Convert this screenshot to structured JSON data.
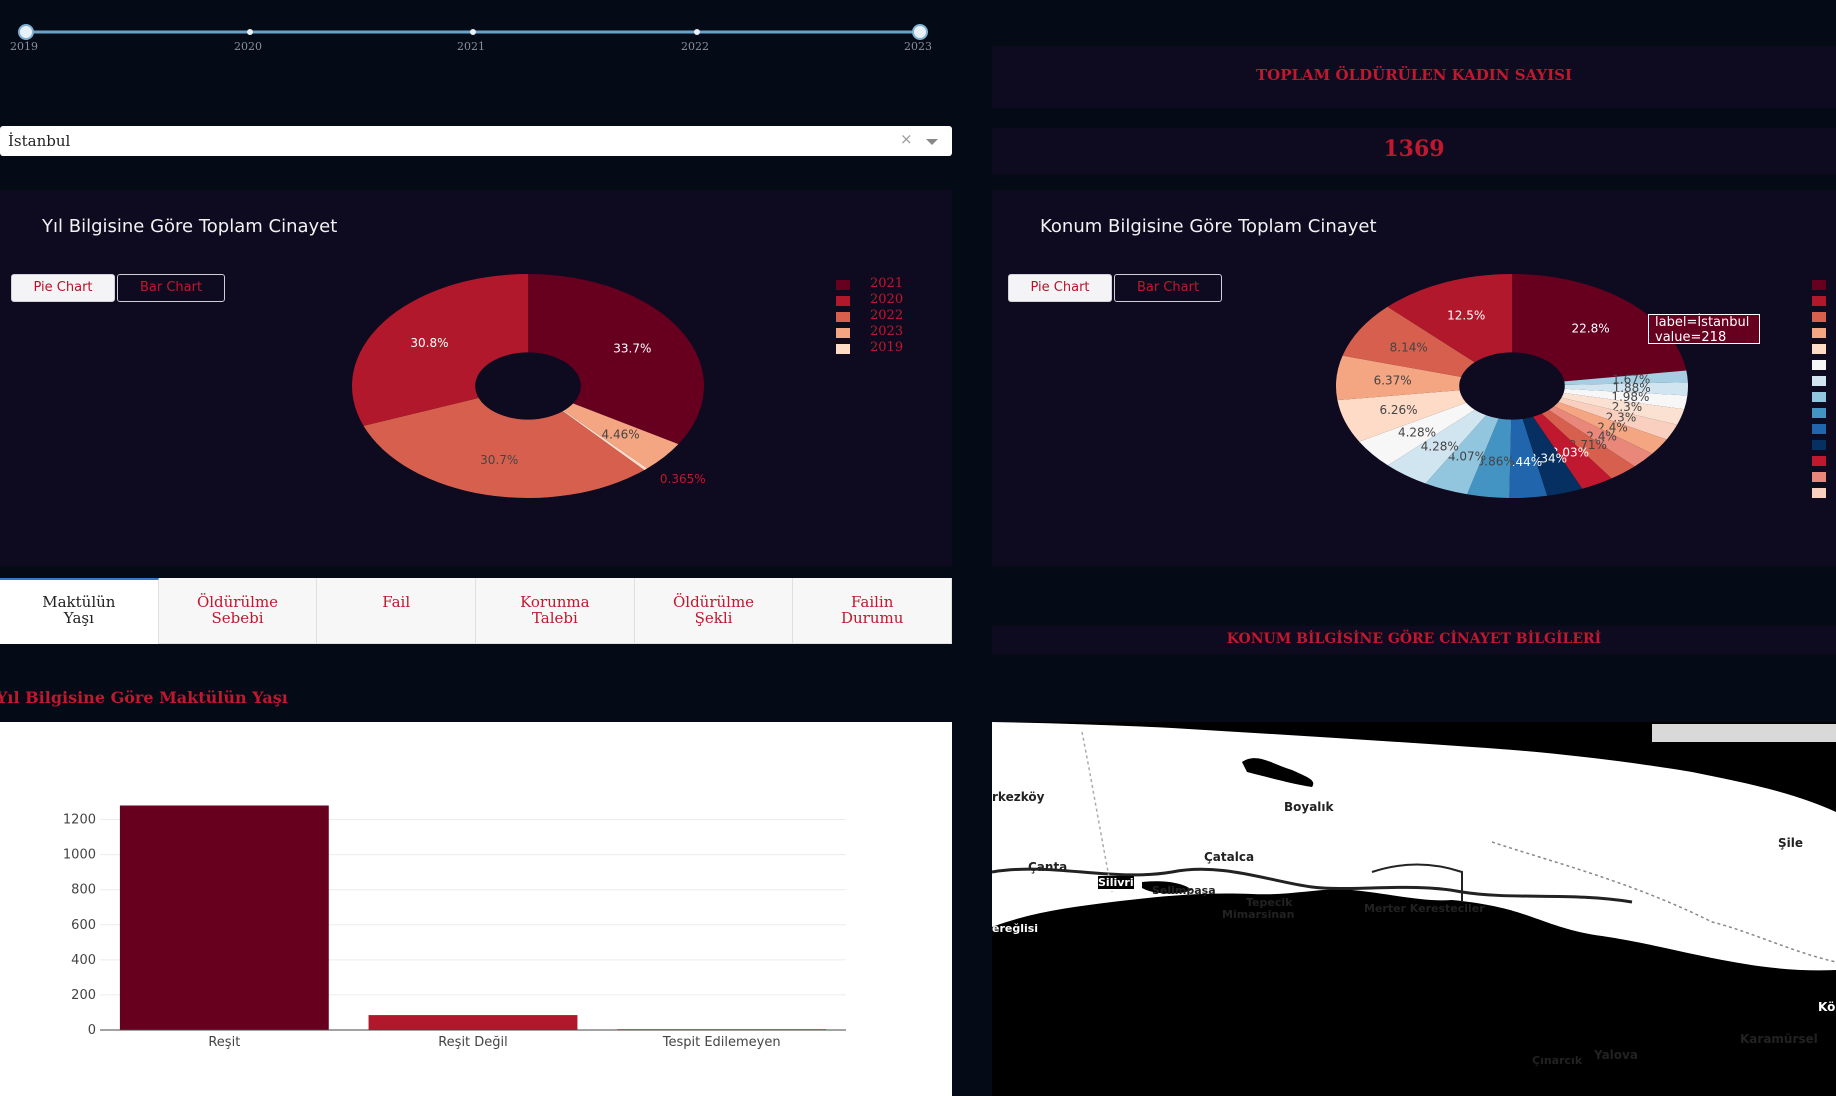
{
  "slider": {
    "ticks": [
      "2019",
      "2020",
      "2021",
      "2022",
      "2023"
    ]
  },
  "dropdown": {
    "value": "İstanbul",
    "clear": "×"
  },
  "kpi": {
    "title": "TOPLAM ÖLDÜRÜLEN KADIN SAYISI",
    "value": "1369"
  },
  "year_chart": {
    "title": "Yıl Bilgisine Göre Toplam Cinayet",
    "pie_button": "Pie Chart",
    "bar_button": "Bar Chart"
  },
  "location_chart": {
    "title": "Konum Bilgisine Göre Toplam Cinayet",
    "pie_button": "Pie Chart",
    "bar_button": "Bar Chart",
    "tooltip": {
      "line1": "label=İstanbul",
      "line2": "value=218"
    }
  },
  "tabs": [
    {
      "label": [
        "Maktülün",
        "Yaşı"
      ]
    },
    {
      "label": [
        "Öldürülme",
        "Sebebi"
      ]
    },
    {
      "label": [
        "Fail"
      ]
    },
    {
      "label": [
        "Korunma",
        "Talebi"
      ]
    },
    {
      "label": [
        "Öldürülme",
        "Şekli"
      ]
    },
    {
      "label": [
        "Failin",
        "Durumu"
      ]
    }
  ],
  "location_section_title": "KONUM BİLGİSİNE GÖRE CİNAYET BİLGİLERİ",
  "age_section_title": "Yıl Bilgisine Göre Maktülün Yaşı",
  "map": {
    "places": [
      "Boyalık",
      "Çatalca",
      "Çanta",
      "Silivri",
      "Selimpaşa",
      "Tepecik",
      "Mimarsinan",
      "Merter Keresteciler",
      "Şile",
      "Çınarcık",
      "Yalova",
      "Karamürsel"
    ],
    "partial_labels": [
      "rkezköy",
      "ereğlisi",
      "Kö"
    ]
  },
  "chart_data": [
    {
      "type": "pie",
      "title": "Yıl Bilgisine Göre Toplam Cinayet",
      "hole": true,
      "slices": [
        {
          "label": "2021",
          "value": 33.7,
          "text": "33.7%",
          "color": "#67001f"
        },
        {
          "label": "2023",
          "value": 4.46,
          "text": "4.46%",
          "color": "#f4a582"
        },
        {
          "label": "2019",
          "value": 0.365,
          "text": "0.365%",
          "color": "#fddbc7"
        },
        {
          "label": "2022",
          "value": 30.7,
          "text": "30.7%",
          "color": "#d6604d"
        },
        {
          "label": "2020",
          "value": 30.8,
          "text": "30.8%",
          "color": "#b2182b"
        }
      ],
      "legend": [
        {
          "label": "2021",
          "color": "#67001f"
        },
        {
          "label": "2020",
          "color": "#b2182b"
        },
        {
          "label": "2022",
          "color": "#d6604d"
        },
        {
          "label": "2023",
          "color": "#f4a582"
        },
        {
          "label": "2019",
          "color": "#fddbc7"
        }
      ]
    },
    {
      "type": "pie",
      "title": "Konum Bilgisine Göre Toplam Cinayet",
      "hole": true,
      "slices": [
        {
          "value": 22.8,
          "text": "22.8%",
          "color": "#67001f"
        },
        {
          "value": 1.67,
          "text": "1.67%",
          "color": "#a6cee3"
        },
        {
          "value": 1.88,
          "text": "1.88%",
          "color": "#d1e5f0"
        },
        {
          "value": 1.98,
          "text": "1.98%",
          "color": "#f7f7f7"
        },
        {
          "value": 2.3,
          "text": "2.3%",
          "color": "#fbe1d2"
        },
        {
          "value": 2.3,
          "text": "2.3%",
          "color": "#f9d0c0"
        },
        {
          "value": 2.4,
          "text": "2.4%",
          "color": "#f4a582"
        },
        {
          "value": 2.4,
          "text": "2.4%",
          "color": "#e8877a"
        },
        {
          "value": 2.71,
          "text": "2.71%",
          "color": "#d6604d"
        },
        {
          "value": 3.03,
          "text": "3.03%",
          "color": "#c0182e"
        },
        {
          "value": 3.34,
          "text": "3.34%",
          "color": "#053061"
        },
        {
          "value": 3.44,
          "text": "3.44%",
          "color": "#2166ac"
        },
        {
          "value": 3.86,
          "text": "3.86%",
          "color": "#4393c3"
        },
        {
          "value": 4.07,
          "text": "4.07%",
          "color": "#92c5de"
        },
        {
          "value": 4.28,
          "text": "4.28%",
          "color": "#d1e5f0"
        },
        {
          "value": 4.28,
          "text": "4.28%",
          "color": "#f7f7f7"
        },
        {
          "value": 6.26,
          "text": "6.26%",
          "color": "#fddbc7"
        },
        {
          "value": 6.37,
          "text": "6.37%",
          "color": "#f4a582"
        },
        {
          "value": 8.14,
          "text": "8.14%",
          "color": "#d6604d"
        },
        {
          "value": 12.5,
          "text": "12.5%",
          "color": "#b2182b"
        }
      ],
      "legend_colors": [
        "#67001f",
        "#b2182b",
        "#d6604d",
        "#f4a582",
        "#fddbc7",
        "#f7f7f7",
        "#d1e5f0",
        "#92c5de",
        "#4393c3",
        "#2166ac",
        "#053061",
        "#c0182e",
        "#e8877a",
        "#f9d0c0"
      ]
    },
    {
      "type": "bar",
      "title": "Yıl Bilgisine Göre Maktülün Yaşı",
      "categories": [
        "Reşit",
        "Reşit Değil",
        "Tespit Edilemeyen"
      ],
      "values": [
        1280,
        85,
        5
      ],
      "ylim": [
        0,
        1300
      ],
      "yticks": [
        0,
        200,
        400,
        600,
        800,
        1000,
        1200
      ],
      "colors": [
        "#67001f",
        "#b2182b",
        "#d6604d"
      ],
      "grid": true
    }
  ]
}
